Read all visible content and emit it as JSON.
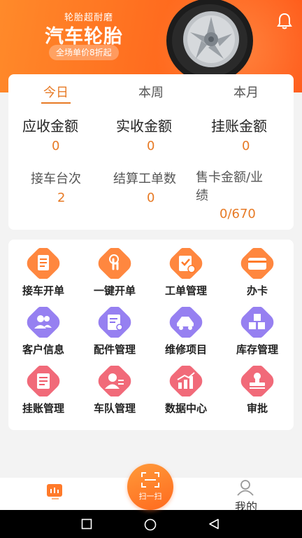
{
  "banner": {
    "slogan": "轮胎超耐磨",
    "title": "汽车轮胎",
    "promo": "全场单价8折起",
    "accent": "#ff6a1e"
  },
  "icons": {
    "notification": "bell-icon",
    "scan": "scan-icon",
    "home": "dashboard-icon",
    "profile": "person-icon"
  },
  "stats": {
    "tabs": [
      "今日",
      "本周",
      "本月"
    ],
    "active_tab": 0,
    "row1": [
      {
        "label": "应收金额",
        "value": "0"
      },
      {
        "label": "实收金额",
        "value": "0"
      },
      {
        "label": "挂账金额",
        "value": "0"
      }
    ],
    "row2": [
      {
        "label": "接车台次",
        "value": "2"
      },
      {
        "label": "结算工单数",
        "value": "0"
      },
      {
        "label_line1": "售卡金额/业",
        "label_line2": "绩",
        "value": "0/670"
      }
    ],
    "value_color": "#e77a25"
  },
  "menu": [
    {
      "label": "接车开单",
      "icon": "document-icon",
      "color": "#ff7a2a"
    },
    {
      "label": "一键开单",
      "icon": "tap-icon",
      "color": "#ff7a2a"
    },
    {
      "label": "工单管理",
      "icon": "clipboard-check-icon",
      "color": "#ff7a2a"
    },
    {
      "label": "办卡",
      "icon": "card-icon",
      "color": "#ff7a2a"
    },
    {
      "label": "客户信息",
      "icon": "customers-icon",
      "color": "#8b72f0"
    },
    {
      "label": "配件管理",
      "icon": "parts-doc-icon",
      "color": "#8b72f0"
    },
    {
      "label": "维修项目",
      "icon": "car-lift-icon",
      "color": "#8b72f0"
    },
    {
      "label": "库存管理",
      "icon": "boxes-icon",
      "color": "#8b72f0"
    },
    {
      "label": "挂账管理",
      "icon": "notes-icon",
      "color": "#f05a6a"
    },
    {
      "label": "车队管理",
      "icon": "team-icon",
      "color": "#f05a6a"
    },
    {
      "label": "数据中心",
      "icon": "bar-chart-icon",
      "color": "#f05a6a"
    },
    {
      "label": "审批",
      "icon": "stamp-icon",
      "color": "#f05a6a"
    }
  ],
  "bottom_nav": {
    "scan_label": "扫一扫",
    "me_label": "我的"
  }
}
